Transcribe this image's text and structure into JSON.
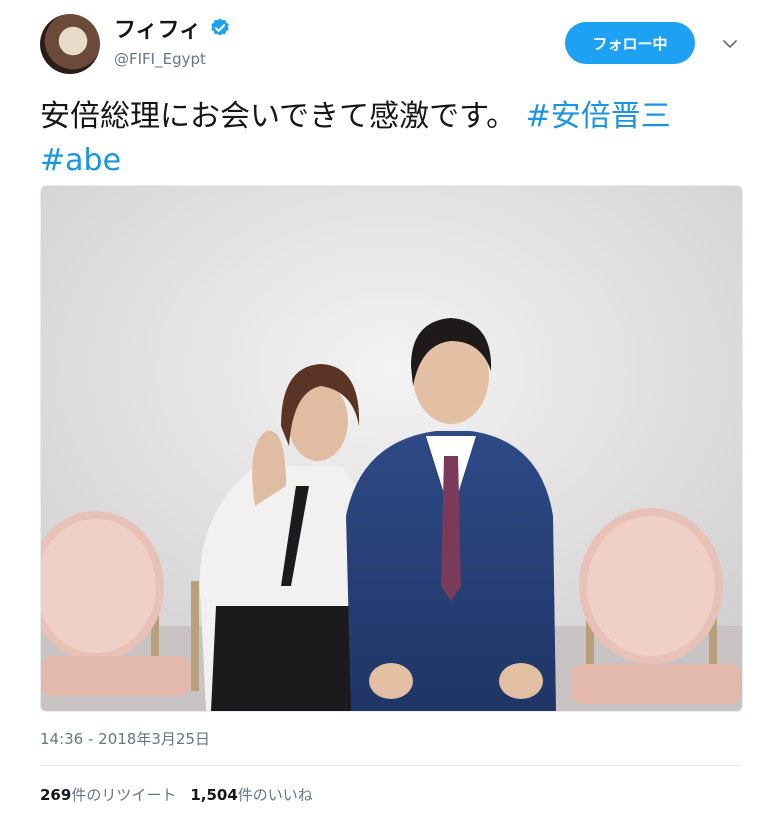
{
  "user": {
    "display_name": "フィフィ",
    "handle": "@FIFI_Egypt"
  },
  "follow_button": {
    "label": "フォロー中"
  },
  "tweet": {
    "text": "安倍総理にお会いできて感激です。",
    "hashtags": [
      "#安倍晋三",
      "#abe"
    ],
    "timestamp": "14:36 - 2018年3月25日"
  },
  "stats": {
    "retweets_count": "269",
    "retweets_label": "件のリツイート",
    "likes_count": "1,504",
    "likes_label": "件のいいね"
  },
  "colors": {
    "accent": "#1da1f2",
    "hashtag": "#1b95e0",
    "muted": "#657786"
  },
  "icons": {
    "verified": "verified-badge-icon",
    "caret": "chevron-down-icon"
  }
}
